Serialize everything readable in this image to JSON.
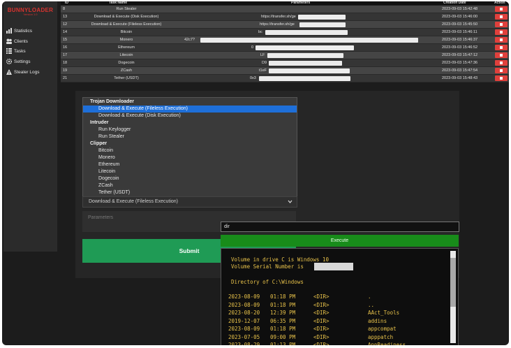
{
  "brand": {
    "name": "BUNNYLOADER",
    "version": "Version 1.0"
  },
  "sidebar": {
    "items": [
      {
        "label": "Statistics",
        "icon": "bar-chart-icon"
      },
      {
        "label": "Clients",
        "icon": "users-icon"
      },
      {
        "label": "Tasks",
        "icon": "tasks-icon"
      },
      {
        "label": "Settings",
        "icon": "gear-icon"
      },
      {
        "label": "Stealer Logs",
        "icon": "warning-icon"
      }
    ]
  },
  "table": {
    "headers": {
      "id": "ID",
      "task": "Task Name",
      "params": "Parameters",
      "date": "Creation Date",
      "action": "Action"
    },
    "rows": [
      {
        "id": "8",
        "task": "Run Stealer",
        "param": "",
        "date": "2023-09-03 15:42:48"
      },
      {
        "id": "13",
        "task": "Download & Execute (Disk Execution)",
        "param": "https://transfer.sh/ge",
        "date": "2023-09-03 15:46:00"
      },
      {
        "id": "12",
        "task": "Download & Execute (Fileless Execution)",
        "param": "https://transfer.sh/ge",
        "date": "2023-09-03 15:45:50"
      },
      {
        "id": "14",
        "task": "Bitcoin",
        "param": "bc",
        "date": "2023-09-03 15:46:11"
      },
      {
        "id": "15",
        "task": "Monero",
        "param": "42c7?",
        "date": "2023-09-03 15:46:37"
      },
      {
        "id": "16",
        "task": "Ethereum",
        "param": "0",
        "date": "2023-09-03 15:46:52"
      },
      {
        "id": "17",
        "task": "Litecoin",
        "param": "LF",
        "date": "2023-09-03 15:47:12"
      },
      {
        "id": "18",
        "task": "Dogecoin",
        "param": "D9",
        "date": "2023-09-03 15:47:36"
      },
      {
        "id": "19",
        "task": "ZCash",
        "param": "t1eF",
        "date": "2023-09-03 15:47:54"
      },
      {
        "id": "21",
        "task": "Tether (USDT)",
        "param": "0x3",
        "date": "2023-09-03 15:48:43"
      }
    ]
  },
  "listbox": {
    "groups": [
      {
        "label": "Trojan Downloader",
        "options": [
          "Download & Execute (Fileless Execution)",
          "Download & Execute (Disk Execution)"
        ]
      },
      {
        "label": "Intruder",
        "options": [
          "Run Keylogger",
          "Run Stealer"
        ]
      },
      {
        "label": "Clipper",
        "options": [
          "Bitcoin",
          "Monero",
          "Ethereum",
          "Litecoin",
          "Dogecoin",
          "ZCash",
          "Tether (USDT)"
        ]
      }
    ],
    "selected": "Download & Execute (Fileless Execution)"
  },
  "form": {
    "select_value": "Download & Execute (Fileless Execution)",
    "params_placeholder": "Parameters",
    "submit_label": "Submit"
  },
  "terminal": {
    "command": "dir",
    "execute_label": "Execute",
    "lines": {
      "volume": "Volume in drive C is Windows 10",
      "serial": "Volume Serial Number is",
      "directory": "Directory of C:\\Windows"
    },
    "entries": [
      {
        "date": "2023-08-09",
        "time": "01:18 PM",
        "type": "<DIR>",
        "name": "."
      },
      {
        "date": "2023-08-09",
        "time": "01:18 PM",
        "type": "<DIR>",
        "name": ".."
      },
      {
        "date": "2023-08-20",
        "time": "12:39 PM",
        "type": "<DIR>",
        "name": "AAct_Tools"
      },
      {
        "date": "2019-12-07",
        "time": "06:35 PM",
        "type": "<DIR>",
        "name": "addins"
      },
      {
        "date": "2023-08-09",
        "time": "01:18 PM",
        "type": "<DIR>",
        "name": "appcompat"
      },
      {
        "date": "2023-07-05",
        "time": "09:00 PM",
        "type": "<DIR>",
        "name": "apppatch"
      },
      {
        "date": "2023-08-29",
        "time": "01:13 PM",
        "type": "<DIR>",
        "name": "AppReadiness"
      }
    ]
  },
  "colors": {
    "accent": "#d9332f",
    "submit": "#1f9b55",
    "execute": "#188c1a",
    "console_text": "#e8c24a",
    "selected_option": "#1e6fd9"
  }
}
